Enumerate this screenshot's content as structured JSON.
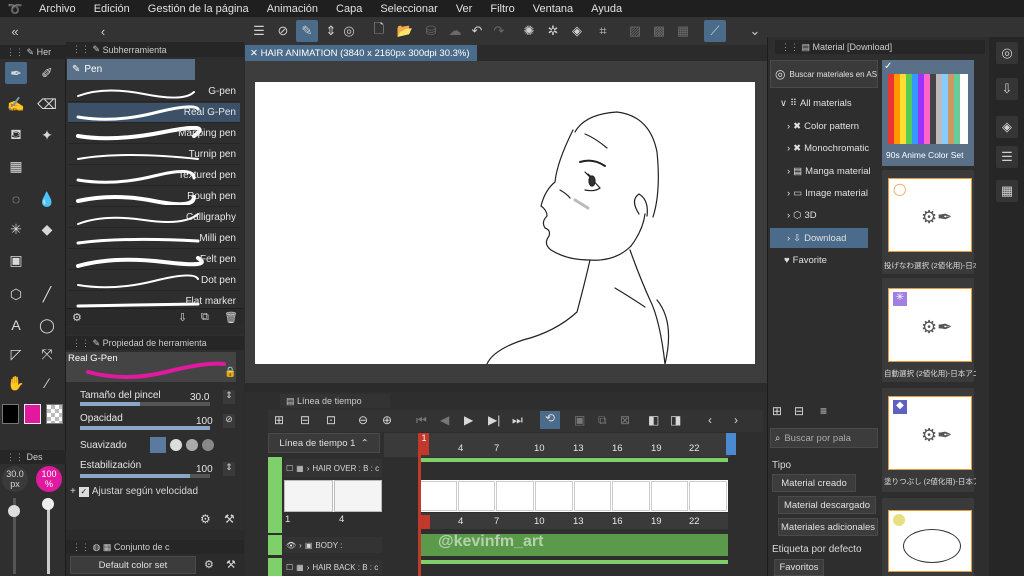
{
  "menu": [
    "Archivo",
    "Edición",
    "Gestión de la página",
    "Animación",
    "Capa",
    "Seleccionar",
    "Ver",
    "Filtro",
    "Ventana",
    "Ayuda"
  ],
  "subtool_panel": {
    "tab_left": "Her",
    "title": "Subherramienta",
    "group": "Pen",
    "pens": [
      "G-pen",
      "Real G-Pen",
      "Mapping pen",
      "Turnip pen",
      "Textured pen",
      "Rough pen",
      "Calligraphy",
      "Milli pen",
      "Felt pen",
      "Dot pen",
      "Flat marker"
    ],
    "selected_index": 1
  },
  "tool_property": {
    "title": "Propiedad de herramienta",
    "preset_name": "Real G-Pen",
    "brush_size_label": "Tamaño del pincel",
    "brush_size_value": "30.0",
    "opacity_label": "Opacidad",
    "opacity_value": "100",
    "smoothing_label": "Suavizado",
    "stabilization_label": "Estabilización",
    "stabilization_value": "100",
    "speed_label": "Ajustar según velocidad"
  },
  "color_set": {
    "tab": "Conjunto de c",
    "selected": "Default color set"
  },
  "left_indicators": {
    "size_value": "30.0",
    "size_unit": "px",
    "opacity_value": "100",
    "opacity_unit": "%",
    "tab": "Des"
  },
  "document": {
    "tab_title": "HAIR ANIMATION (3840 x 2160px 300dpi 30.3%)"
  },
  "timeline": {
    "tab_title": "Línea de tiempo",
    "timeline_name": "Línea de tiempo 1",
    "current_frame": "1",
    "ruler": [
      "4",
      "7",
      "10",
      "13",
      "16",
      "19",
      "22"
    ],
    "lane_numbers": [
      "4",
      "7",
      "10",
      "13",
      "16",
      "19",
      "22"
    ],
    "thumb_numbers": [
      "1",
      "4"
    ],
    "tracks": [
      "HAIR OVER : B : c",
      "BODY :",
      "HAIR BACK : B : c"
    ],
    "watermark": "@kevinfm_art"
  },
  "material_panel": {
    "title": "Material [Download]",
    "search_button": "Buscar materiales en ASS",
    "tree": [
      "All materials",
      "Color pattern",
      "Monochromatic",
      "Manga material",
      "Image material",
      "3D",
      "Download",
      "Favorite"
    ],
    "selected_tree": "Download",
    "thumbs": [
      "90s Anime Color Set",
      "投げなわ選択 (2値化用)-日本",
      "自動選択 (2値化用)-日本アニ",
      "塗りつぶし (2値化用)-日本ア"
    ],
    "search_placeholder": "Buscar por pala",
    "type_label": "Tipo",
    "type_buttons": [
      "Material creado",
      "Material descargado",
      "Materiales adicionales"
    ],
    "tag_label": "Etiqueta por defecto",
    "tag_buttons": [
      "Favoritos"
    ]
  },
  "colors": {
    "accent": "#4a6b8a",
    "magenta": "#e0199f",
    "timeline_green": "#7fcf6a",
    "playhead_red": "#c0392b"
  }
}
